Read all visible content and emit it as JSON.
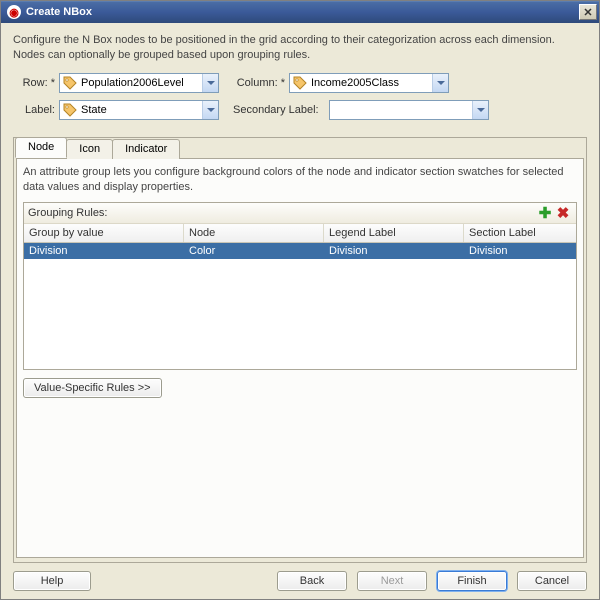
{
  "title": "Create NBox",
  "description": "Configure the N Box nodes to be positioned in the grid according to their categorization across each dimension. Nodes can optionally be grouped based upon grouping rules.",
  "labels": {
    "row": "Row: *",
    "column": "Column: *",
    "label": "Label:",
    "secondaryLabel": "Secondary Label:"
  },
  "values": {
    "row": "Population2006Level",
    "column": "Income2005Class",
    "label": "State",
    "secondaryLabel": ""
  },
  "tabs": {
    "node": "Node",
    "icon": "Icon",
    "indicator": "Indicator"
  },
  "attrDesc": "An attribute group lets you configure background colors of the node and indicator section swatches for selected data values and display properties.",
  "groupingRules": {
    "title": "Grouping Rules:",
    "columns": {
      "groupBy": "Group by value",
      "node": "Node",
      "legend": "Legend Label",
      "section": "Section Label"
    },
    "rows": [
      {
        "groupBy": "Division",
        "node": "Color",
        "legend": "Division",
        "section": "Division"
      }
    ]
  },
  "valueSpecific": "Value-Specific Rules >>",
  "buttons": {
    "help": "Help",
    "back": "Back",
    "next": "Next",
    "finish": "Finish",
    "cancel": "Cancel"
  }
}
